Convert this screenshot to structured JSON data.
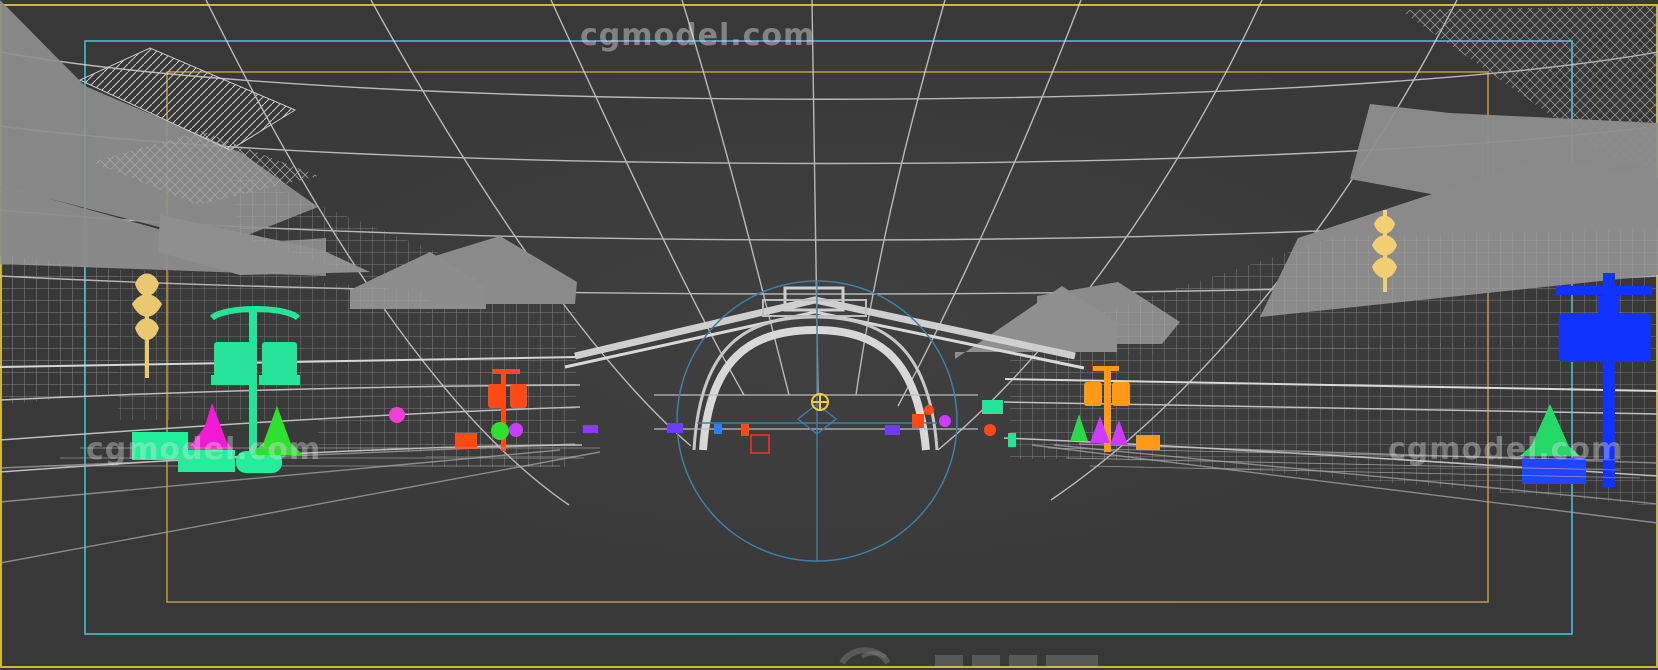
{
  "viewport": {
    "background": "#3a3a3a",
    "frame_colors": {
      "viewport_border": "#d4b82a",
      "safe_frame_outer": "#39c3d6",
      "safe_frame_inner": "#c9a23a",
      "wireframe_gray": "#bdbdbd",
      "bridge_gray": "#c8c8c8",
      "sky_dome": "#d8d8d8",
      "camera_gizmo": "#f1d12a",
      "camera_target": "#3d7fa7"
    }
  },
  "watermarks": {
    "top": "cgmodel.com",
    "left": "cgmodel.com",
    "right": "cgmodel.com"
  },
  "objects": {
    "left_lamp_color": "#26e39a",
    "left_planter_color": "#1ff09a",
    "left_tree_magenta": "#f31ad3",
    "left_tree_green": "#2ee02f",
    "left_lantern_color": "#e8c870",
    "center_left_lamp_color": "#ff4a16",
    "right_lamp_color": "#ff9a18",
    "right_tree_purple": "#cc3cff",
    "right_tree_green": "#2ed64f",
    "right_lantern_color": "#f2cf72",
    "right_sign_color": "#1033ff",
    "right_planter_color": "#1f45ff",
    "right_tree_far_green": "#24d86a"
  }
}
